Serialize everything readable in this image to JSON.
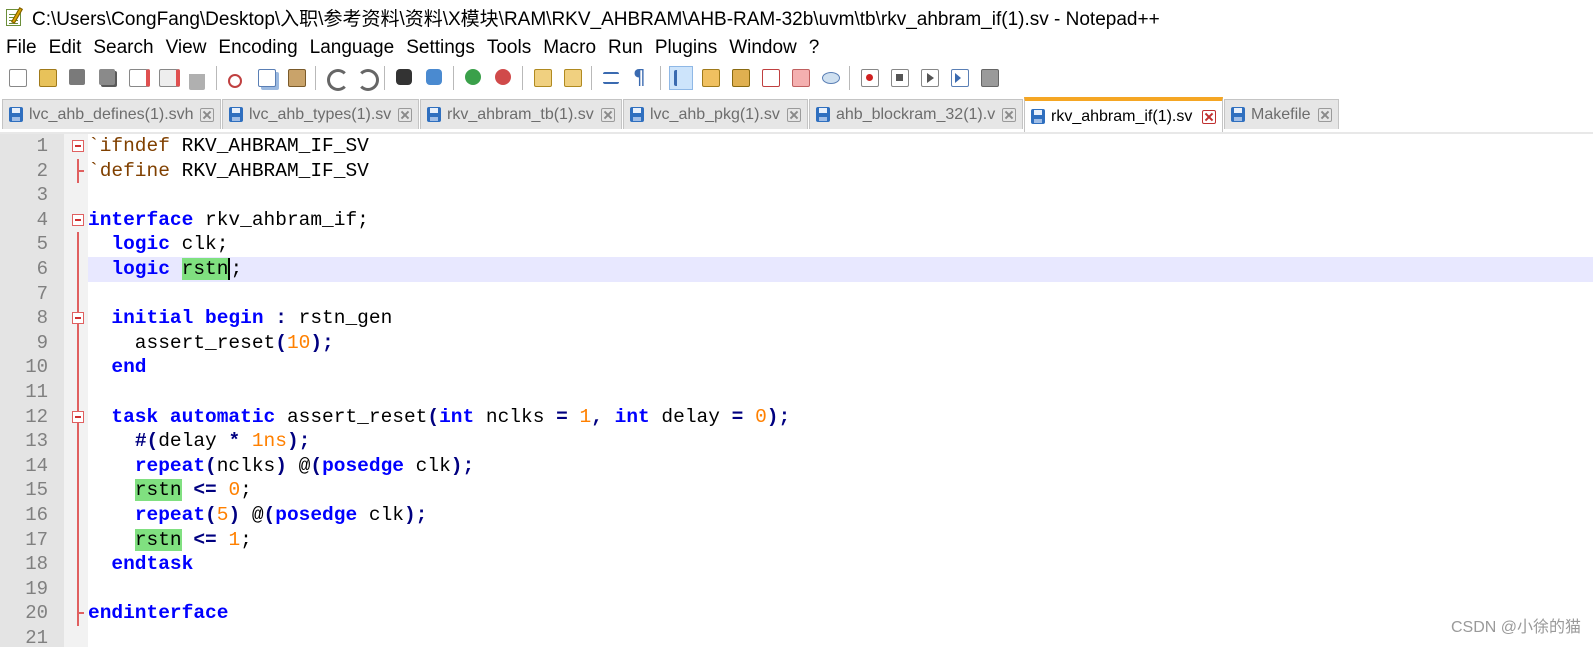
{
  "window": {
    "title": "C:\\Users\\CongFang\\Desktop\\入职\\参考资料\\资料\\X模块\\RAM\\RKV_AHBRAM\\AHB-RAM-32b\\uvm\\tb\\rkv_ahbram_if(1).sv - Notepad++"
  },
  "menu": {
    "items": [
      "File",
      "Edit",
      "Search",
      "View",
      "Encoding",
      "Language",
      "Settings",
      "Tools",
      "Macro",
      "Run",
      "Plugins",
      "Window",
      "?"
    ]
  },
  "toolbar": {
    "icons": [
      "new-file-icon",
      "open-file-icon",
      "save-icon",
      "save-all-icon",
      "close-icon",
      "close-all-icon",
      "print-icon",
      "cut-icon",
      "copy-icon",
      "paste-icon",
      "undo-icon",
      "redo-icon",
      "find-icon",
      "replace-icon",
      "zoom-in-icon",
      "zoom-out-icon",
      "sync-vertical-icon",
      "sync-horizontal-icon",
      "word-wrap-icon",
      "show-all-chars-icon",
      "indent-guide-icon",
      "doc-map-icon",
      "function-list-icon",
      "folder-workspace-icon",
      "monitoring-icon",
      "record-macro-icon",
      "stop-record-icon",
      "play-macro-icon",
      "run-macro-multiple-icon",
      "save-macro-icon"
    ]
  },
  "tabs": [
    {
      "label": "lvc_ahb_defines(1).svh",
      "active": false
    },
    {
      "label": "lvc_ahb_types(1).sv",
      "active": false
    },
    {
      "label": "rkv_ahbram_tb(1).sv",
      "active": false
    },
    {
      "label": "lvc_ahb_pkg(1).sv",
      "active": false
    },
    {
      "label": "ahb_blockram_32(1).v",
      "active": false
    },
    {
      "label": "rkv_ahbram_if(1).sv",
      "active": true
    },
    {
      "label": "Makefile",
      "active": false
    }
  ],
  "editor": {
    "line_numbers": [
      "1",
      "2",
      "3",
      "4",
      "5",
      "6",
      "7",
      "8",
      "9",
      "10",
      "11",
      "12",
      "13",
      "14",
      "15",
      "16",
      "17",
      "18",
      "19",
      "20",
      "21"
    ],
    "current_line": 6,
    "colors": {
      "keyword": "#0000ff",
      "number": "#ff8000",
      "highlight": "#80e080",
      "current_line": "#e8e8ff"
    }
  },
  "watermark": "CSDN @小徐的猫"
}
